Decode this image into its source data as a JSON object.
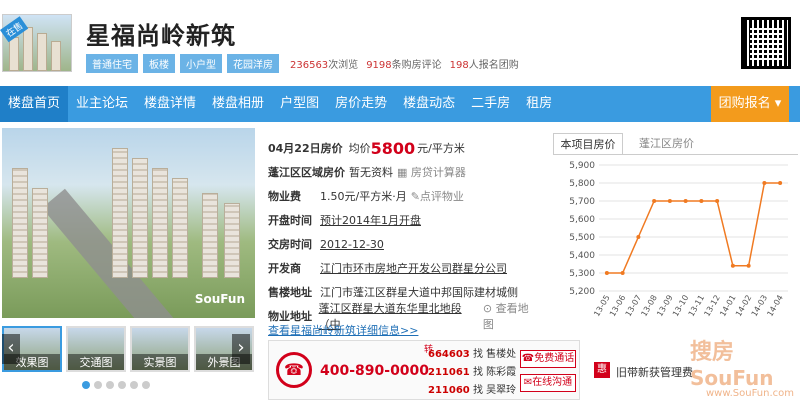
{
  "header": {
    "sale_badge": "在售",
    "title": "星福尚岭新筑",
    "tags": [
      "普通住宅",
      "板楼",
      "小户型",
      "花园洋房"
    ],
    "stats": [
      {
        "num": "236563",
        "label": "次浏览"
      },
      {
        "num": "9198",
        "label": "条购房评论"
      },
      {
        "num": "198",
        "label": "人报名团购"
      }
    ]
  },
  "nav": {
    "items": [
      "楼盘首页",
      "业主论坛",
      "楼盘详情",
      "楼盘相册",
      "户型图",
      "房价走势",
      "楼盘动态",
      "二手房",
      "租房"
    ],
    "join": "团购报名 ▾"
  },
  "gallery": {
    "watermark": "SouFun",
    "thumbs": [
      "效果图",
      "交通图",
      "实景图",
      "外景图"
    ]
  },
  "info": {
    "date_price_label": "04月22日房价",
    "avg_label": "均价",
    "price": "5800",
    "price_unit": "元/平方米",
    "region_label": "蓬江区区域房价",
    "region_value": "暂无资料",
    "calc": "房贷计算器",
    "mgmt_label": "物业费",
    "mgmt_value": "1.50元/平方米·月",
    "review": "点评物业",
    "open_label": "开盘时间",
    "open_value": "预计2014年1月开盘",
    "deliver_label": "交房时间",
    "deliver_value": "2012-12-30",
    "dev_label": "开发商",
    "dev_value": "江门市环市房地产开发公司群星分公司",
    "sales_label": "售楼地址",
    "sales_value": "江门市蓬江区群星大道中邦国际建材城侧",
    "addr_label": "物业地址",
    "addr_value": "蓬江区群星大道东华里北地段（中",
    "map": "查看地图",
    "more": "查看星福尚岭新筑详细信息>>"
  },
  "contact": {
    "phone": "400-890-0000",
    "ext": "转",
    "agents": [
      {
        "num": "664603",
        "name": "找 售楼处"
      },
      {
        "num": "211061",
        "name": "找 陈彩霞"
      },
      {
        "num": "211060",
        "name": "找 吴翠玲"
      }
    ],
    "free_call": "免费通话",
    "online": "在线沟通",
    "hui": "惠",
    "hui_text": "旧带新获管理费"
  },
  "brand": {
    "logo": "搜房",
    "site": "SouFun",
    "url": "www.SouFun.com"
  },
  "chart_tabs": [
    "本项目房价",
    "蓬江区房价"
  ],
  "chart_data": {
    "type": "line",
    "x": [
      "13-05",
      "13-06",
      "13-07",
      "13-08",
      "13-09",
      "13-10",
      "13-11",
      "13-12",
      "14-01",
      "14-02",
      "14-03",
      "14-04"
    ],
    "values": [
      5300,
      5300,
      5500,
      5700,
      5700,
      5700,
      5700,
      5700,
      5340,
      5340,
      5800,
      5800
    ],
    "yticks": [
      "5,900",
      "5,800",
      "5,700",
      "5,600",
      "5,500",
      "5,400",
      "5,300",
      "5,200"
    ],
    "ylim": [
      5200,
      5900
    ],
    "color": "#f07a22",
    "grid": true
  }
}
